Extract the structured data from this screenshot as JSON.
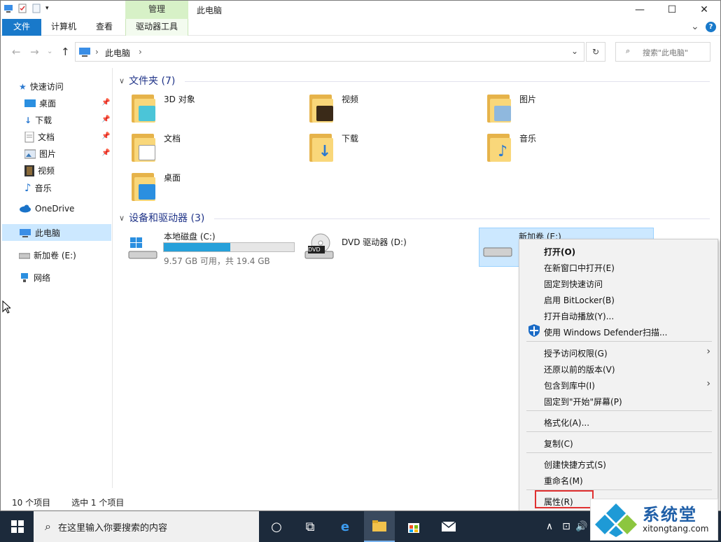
{
  "window": {
    "title": "此电脑",
    "contextual_tab_group": "管理",
    "controls": {
      "minimize": "—",
      "maximize": "☐",
      "close": "✕"
    }
  },
  "ribbon": {
    "tabs": [
      "文件",
      "计算机",
      "查看",
      "驱动器工具"
    ],
    "expand": "⌄",
    "help": "?"
  },
  "address": {
    "path": "此电脑",
    "separator": "›",
    "search_placeholder": "搜索\"此电脑\""
  },
  "nav": {
    "quick_access": "快速访问",
    "quick_items": [
      "桌面",
      "下载",
      "文档",
      "图片",
      "视频",
      "音乐"
    ],
    "onedrive": "OneDrive",
    "this_pc": "此电脑",
    "new_volume": "新加卷 (E:)",
    "network": "网络"
  },
  "content": {
    "folders_header": "文件夹 (7)",
    "folders": [
      "3D 对象",
      "视频",
      "图片",
      "文档",
      "下载",
      "音乐",
      "桌面"
    ],
    "devices_header": "设备和驱动器 (3)",
    "drives": [
      {
        "name": "本地磁盘 (C:)",
        "info": "9.57 GB 可用，共 19.4 GB",
        "used_fraction": 0.51
      },
      {
        "name": "DVD 驱动器 (D:)",
        "badge": "DVD"
      },
      {
        "name": "新加卷 (E:)"
      }
    ]
  },
  "context_menu": {
    "items": [
      "打开(O)",
      "在新窗口中打开(E)",
      "固定到快速访问",
      "启用 BitLocker(B)",
      "打开自动播放(Y)...",
      "使用 Windows Defender扫描...",
      "授予访问权限(G)",
      "还原以前的版本(V)",
      "包含到库中(I)",
      "固定到\"开始\"屏幕(P)",
      "格式化(A)...",
      "复制(C)",
      "创建快捷方式(S)",
      "重命名(M)",
      "属性(R)"
    ]
  },
  "status": {
    "count": "10 个项目",
    "selected": "选中 1 个项目"
  },
  "taskbar": {
    "search_placeholder": "在这里输入你要搜索的内容"
  },
  "watermark": {
    "title": "系统堂",
    "url": "xitongtang.com"
  },
  "colors": {
    "accent": "#1979ca",
    "selection": "#cce8ff",
    "highlight_box": "#e03030",
    "taskbar": "#1c2a3b"
  }
}
